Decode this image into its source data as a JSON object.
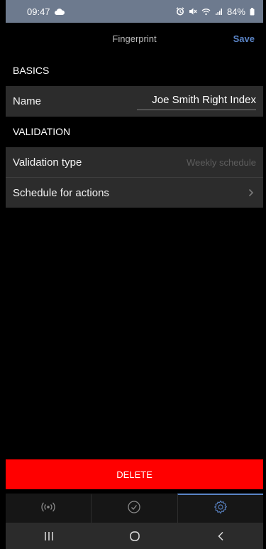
{
  "status_bar": {
    "time": "09:47",
    "battery": "84%",
    "icons": [
      "cloud-icon",
      "alarm-icon",
      "mute-icon",
      "wifi-icon",
      "signal-icon",
      "battery-icon"
    ]
  },
  "header": {
    "title": "Fingerprint",
    "save_label": "Save"
  },
  "sections": {
    "basics": "BASICS",
    "validation": "VALIDATION"
  },
  "rows": {
    "name": {
      "label": "Name",
      "value": "Joe Smith Right Index"
    },
    "validation_type": {
      "label": "Validation type",
      "value": "Weekly schedule"
    },
    "schedule": {
      "label": "Schedule for actions"
    }
  },
  "delete_label": "DELETE",
  "tabs": [
    {
      "icon": "broadcast-icon",
      "active": false
    },
    {
      "icon": "clock-check-icon",
      "active": false
    },
    {
      "icon": "gear-icon",
      "active": true
    }
  ],
  "system_nav": [
    "recents-icon",
    "home-icon",
    "back-icon"
  ],
  "colors": {
    "status_bar": "#6d7a8e",
    "accent": "#5a84c6",
    "row_bg": "#2c2c2c",
    "delete": "#ff0000"
  }
}
